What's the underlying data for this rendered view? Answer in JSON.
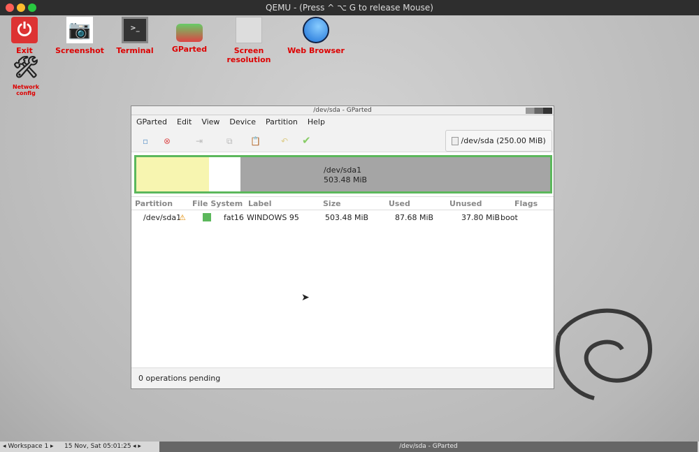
{
  "host": {
    "title": "QEMU - (Press ^ ⌥ G  to release Mouse)"
  },
  "desktop": {
    "icons": [
      {
        "label": "Exit",
        "icon": "power-icon"
      },
      {
        "label": "Screenshot",
        "icon": "camera-icon"
      },
      {
        "label": "Terminal",
        "icon": "terminal-icon"
      },
      {
        "label": "GParted",
        "icon": "disk-icon"
      },
      {
        "label": "Screen resolution",
        "icon": "monitor-icon"
      },
      {
        "label": "Web Browser",
        "icon": "globe-icon"
      },
      {
        "label": "Network config",
        "icon": "tools-icon"
      }
    ]
  },
  "window": {
    "title": "/dev/sda - GParted",
    "menu": [
      "GParted",
      "Edit",
      "View",
      "Device",
      "Partition",
      "Help"
    ],
    "device": "/dev/sda (250.00 MiB)",
    "disk_map": {
      "name": "/dev/sda1",
      "size": "503.48 MiB",
      "used_fraction": 0.17,
      "colors": {
        "used": "#f7f5b0",
        "unused": "#ffffff",
        "border": "#5cb85c"
      }
    },
    "columns": [
      "Partition",
      "File System",
      "Label",
      "Size",
      "Used",
      "Unused",
      "Flags"
    ],
    "rows": [
      {
        "partition": "/dev/sda1",
        "fs": "fat16",
        "label": "WINDOWS 95",
        "size": "503.48 MiB",
        "used": "87.68 MiB",
        "unused": "37.80 MiB",
        "flags": "boot",
        "fs_color": "#5cb85c"
      }
    ],
    "status": "0 operations pending"
  },
  "taskbar": {
    "workspace": "Workspace 1",
    "clock": "15 Nov, Sat 05:01:25",
    "task": "/dev/sda - GParted"
  }
}
